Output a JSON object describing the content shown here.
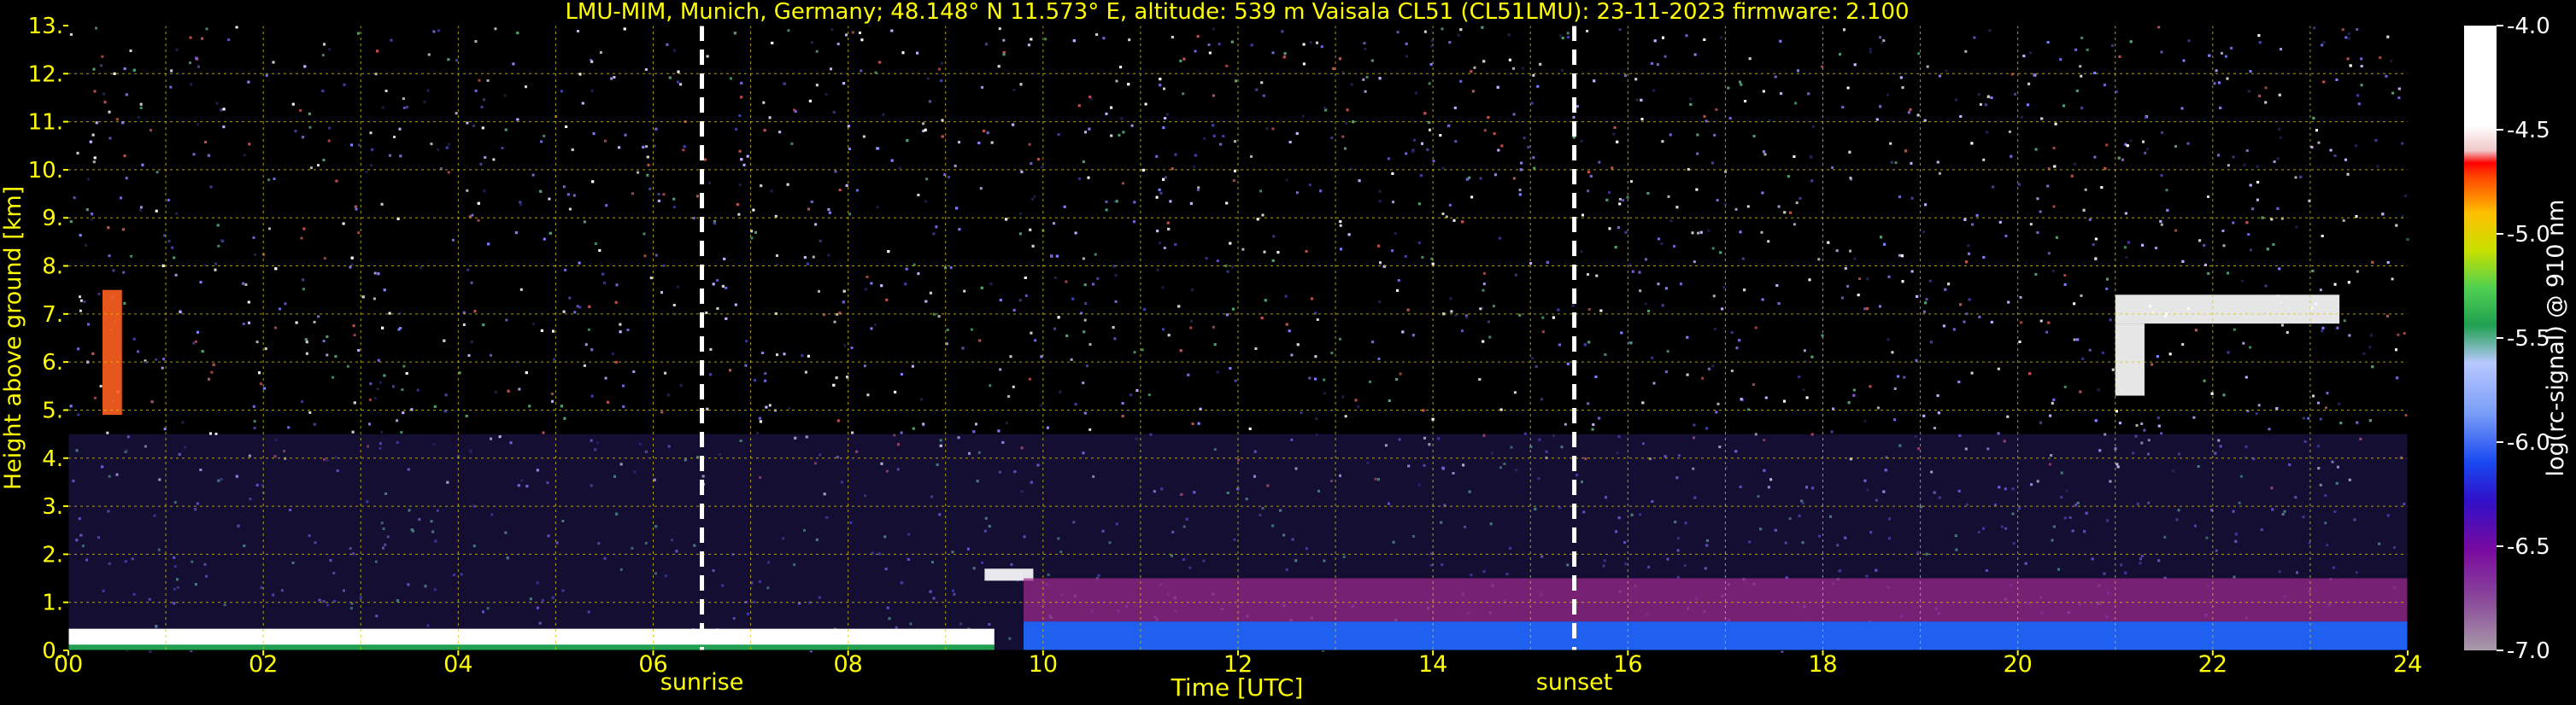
{
  "chart_data": {
    "type": "heatmap",
    "title": "LMU-MIM, Munich, Germany; 48.148° N 11.573° E, altitude: 539 m    Vaisala CL51 (CL51LMU): 23-11-2023    firmware: 2.100",
    "xlabel": "Time [UTC]",
    "ylabel": "Height above ground [km]",
    "colorbar_label": "log(rc-signal) @ 910 nm",
    "x_ticks": [
      "00",
      "02",
      "04",
      "06",
      "08",
      "10",
      "12",
      "14",
      "16",
      "18",
      "20",
      "22",
      "24"
    ],
    "y_ticks": [
      "0.",
      "1.",
      "2.",
      "3.",
      "4.",
      "5.",
      "6.",
      "7.",
      "8.",
      "9.",
      "10.",
      "11.",
      "12.",
      "13."
    ],
    "colorbar_ticks": [
      "-4.0",
      "-4.5",
      "-5.0",
      "-5.5",
      "-6.0",
      "-6.5",
      "-7.0"
    ],
    "xlim": [
      0,
      24
    ],
    "ylim": [
      0,
      13
    ],
    "clim": [
      -7.0,
      -4.0
    ],
    "grid": true,
    "events": [
      {
        "name": "sunrise",
        "x": 6.5
      },
      {
        "name": "sunset",
        "x": 15.45
      }
    ],
    "colors": {
      "text": "#ffff00",
      "grid": "#d8c800",
      "background": "#000000",
      "event_line": "#ffffff",
      "colorbar_text": "#ffffff"
    },
    "features": [
      {
        "kind": "boundary_layer",
        "x": [
          0,
          9.5
        ],
        "height_km": [
          0.1,
          0.45
        ]
      },
      {
        "kind": "cloud",
        "x": [
          9.4,
          9.9
        ],
        "height_km": [
          1.45,
          1.7
        ]
      },
      {
        "kind": "aerosol_layer",
        "x": [
          9.8,
          24
        ],
        "height_km": [
          0,
          1.2
        ]
      },
      {
        "kind": "cloud",
        "x": [
          0.35,
          0.55
        ],
        "height_km": [
          4.9,
          7.5
        ]
      },
      {
        "kind": "cloud",
        "x": [
          21.0,
          21.3
        ],
        "height_km": [
          5.3,
          6.8
        ]
      },
      {
        "kind": "cloud",
        "x": [
          21.0,
          23.3
        ],
        "height_km": [
          6.8,
          7.4
        ]
      }
    ]
  }
}
